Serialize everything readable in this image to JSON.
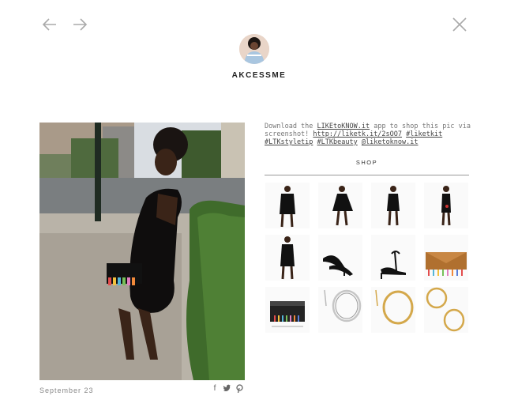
{
  "nav": {
    "prev_icon": "arrow-left-icon",
    "next_icon": "arrow-right-icon",
    "close_icon": "close-icon"
  },
  "profile": {
    "username": "AKCESSME",
    "avatar": "profile-avatar"
  },
  "post": {
    "description_prefix": "Download the",
    "app_link": "LIKEtoKNOW.it",
    "description_middle": "app to shop this pic via screenshot!",
    "short_link": "http://liketk.it/2sOO7",
    "tags": [
      "#liketkit",
      "#LTKstyletip",
      "#LTKbeauty",
      "@liketoknow.it"
    ],
    "date": "September 23",
    "share_icons": [
      "facebook-icon",
      "twitter-icon",
      "pinterest-icon"
    ]
  },
  "shop": {
    "title": "SHOP",
    "products": [
      {
        "kind": "black dress"
      },
      {
        "kind": "black dress"
      },
      {
        "kind": "black dress"
      },
      {
        "kind": "black dress"
      },
      {
        "kind": "black dress"
      },
      {
        "kind": "black heels"
      },
      {
        "kind": "black sandal"
      },
      {
        "kind": "tassel clutch"
      },
      {
        "kind": "tassel clutch"
      },
      {
        "kind": "silver hoops"
      },
      {
        "kind": "gold hoops"
      },
      {
        "kind": "gold hoops"
      }
    ]
  },
  "colors": {
    "accent_gold": "#d4a84b",
    "text_dark": "#222222",
    "text_muted": "#888888"
  }
}
